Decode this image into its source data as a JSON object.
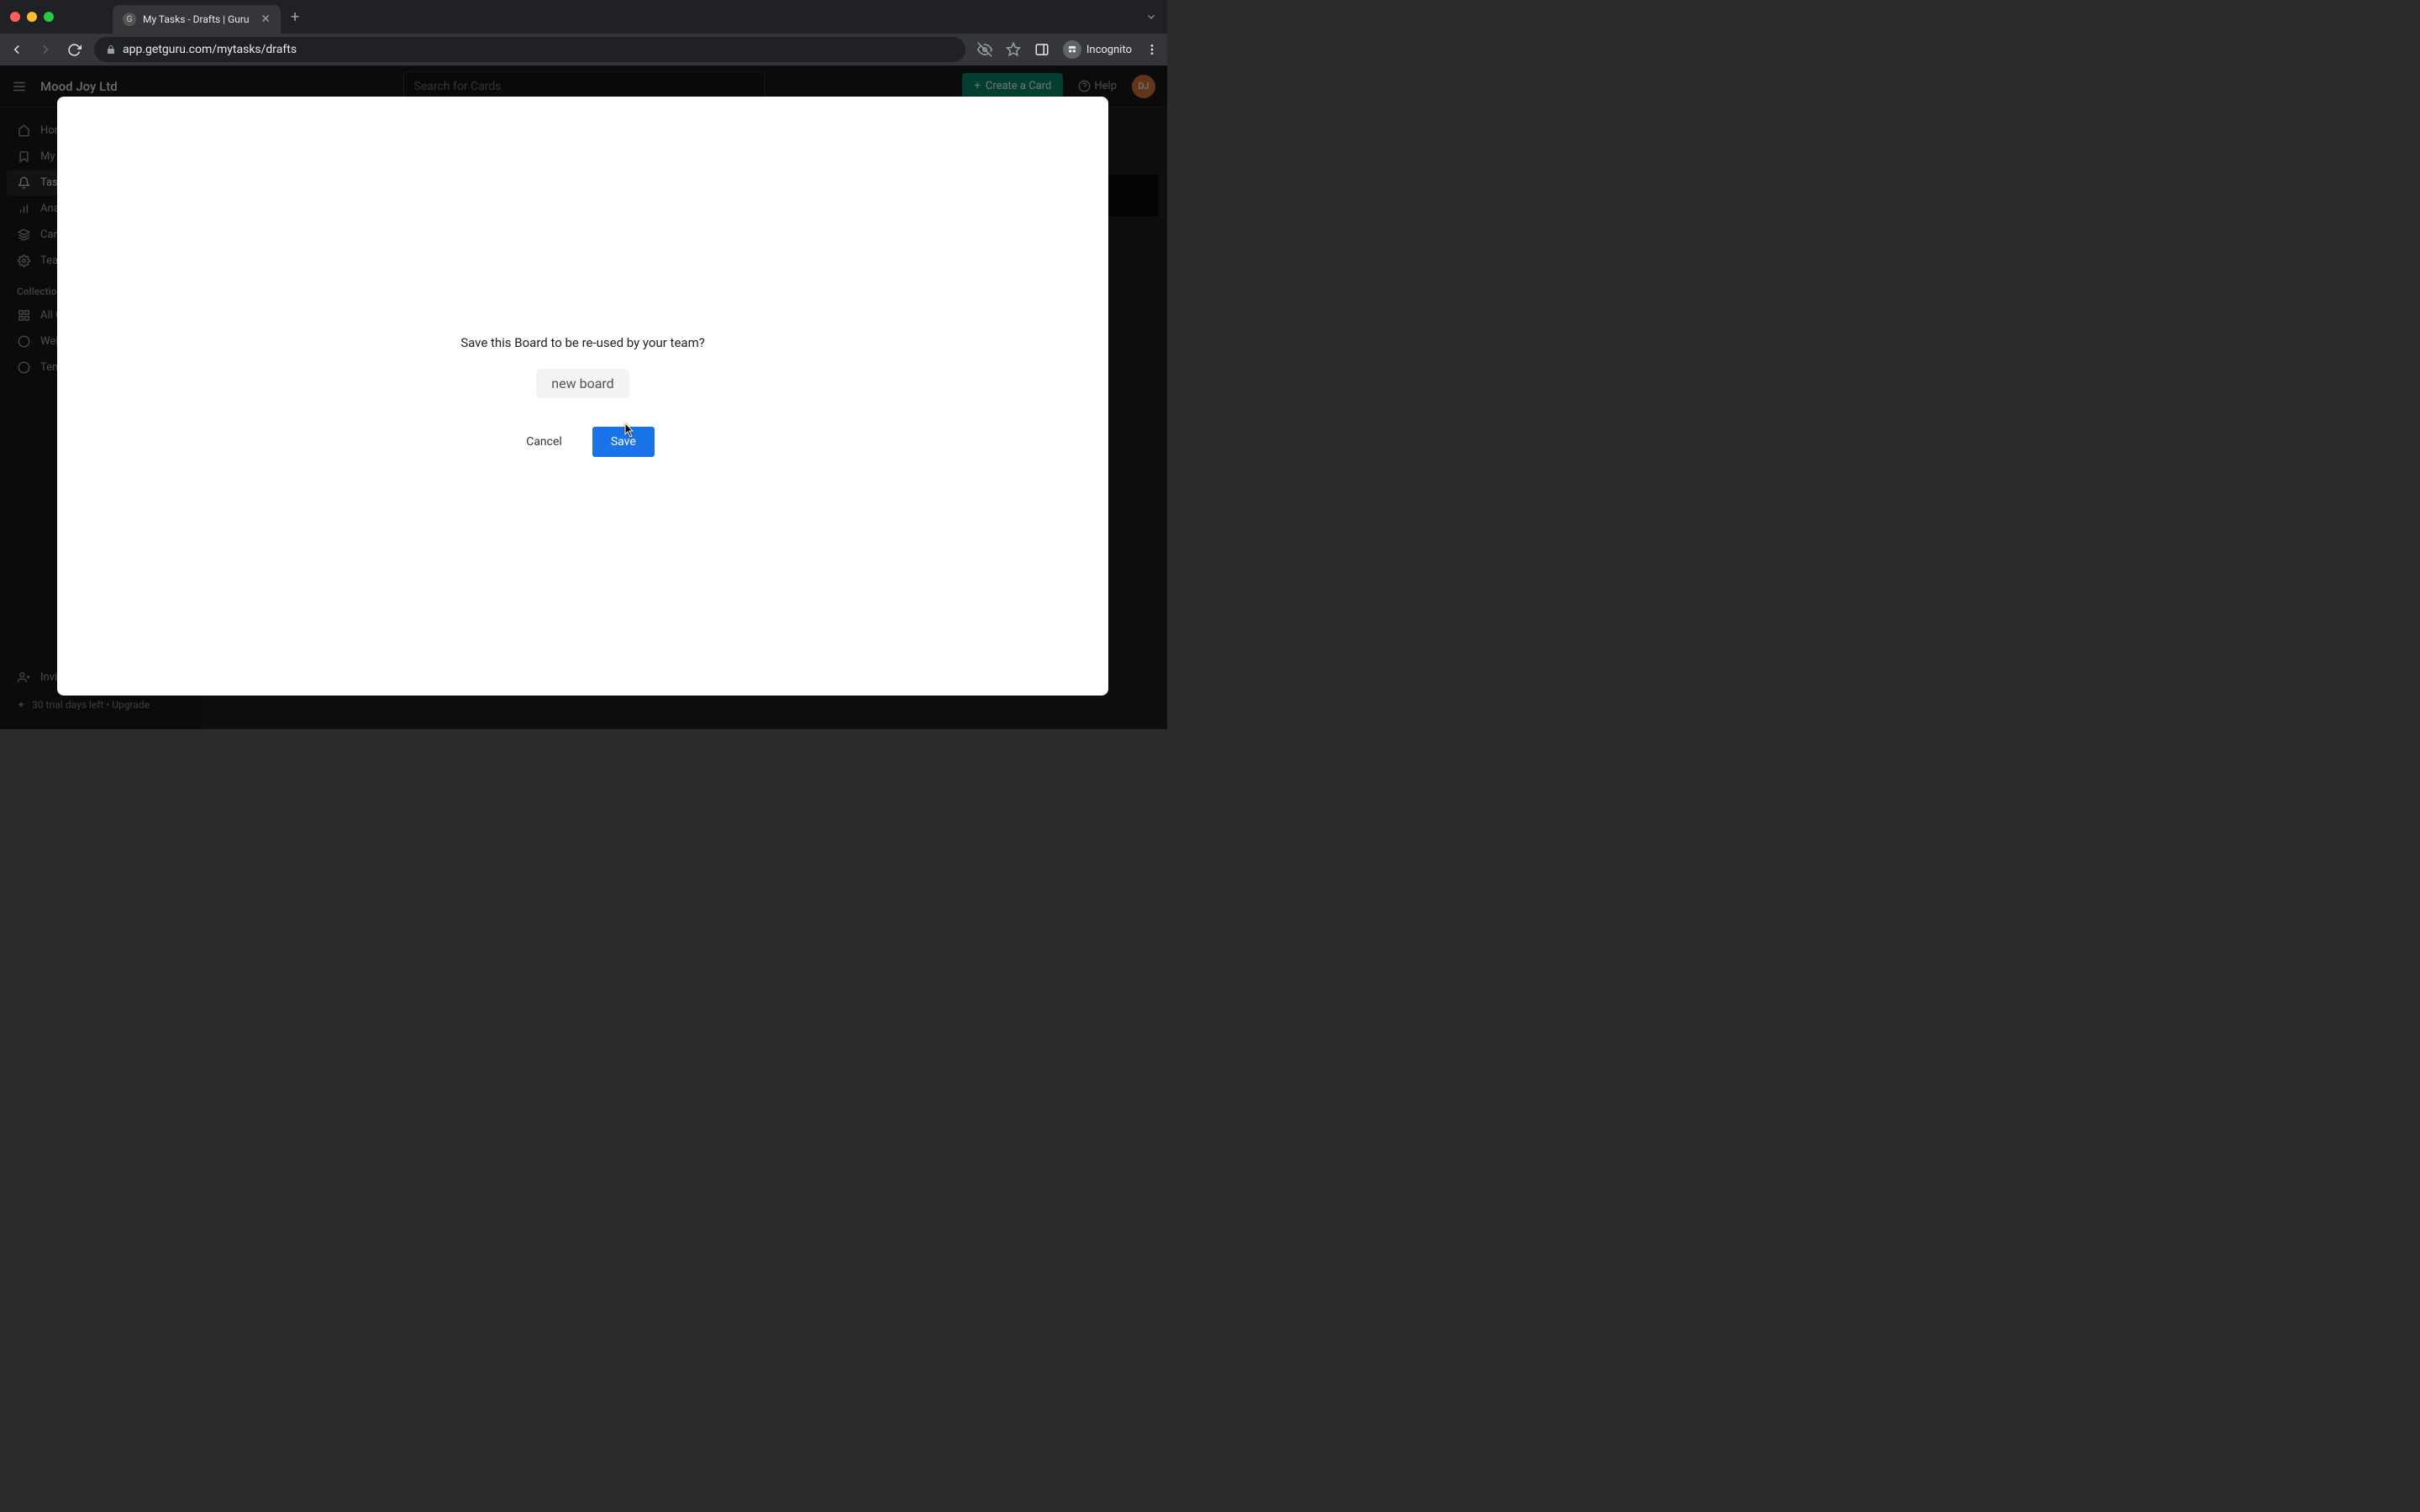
{
  "browser": {
    "tab_title": "My Tasks - Drafts | Guru",
    "url": "app.getguru.com/mytasks/drafts",
    "incognito_label": "Incognito"
  },
  "topbar": {
    "org_name": "Mood Joy Ltd",
    "search_placeholder": "Search for Cards",
    "create_card_label": "Create a Card",
    "help_label": "Help",
    "avatar_initials": "DJ"
  },
  "sidebar": {
    "items": [
      {
        "label": "Home"
      },
      {
        "label": "My Library"
      },
      {
        "label": "Tasks"
      },
      {
        "label": "Analytics"
      },
      {
        "label": "Card Manager"
      },
      {
        "label": "Team Settings"
      }
    ],
    "section_label": "Collections",
    "collections": [
      {
        "label": "All Collections"
      },
      {
        "label": "Welcome to Guru!"
      },
      {
        "label": "Templates"
      }
    ],
    "invite_label": "Invite teammates",
    "trial_label": "30 trial days left • Upgrade"
  },
  "modal": {
    "message": "Save this Board to be re-used by your team?",
    "board_name": "new board",
    "cancel_label": "Cancel",
    "save_label": "Save"
  }
}
